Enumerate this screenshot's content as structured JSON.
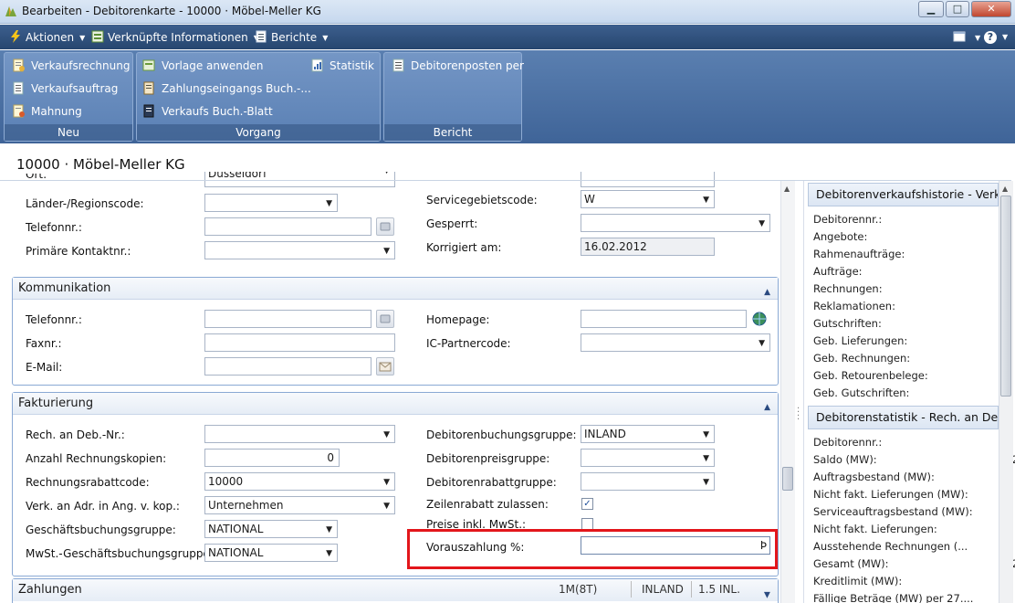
{
  "window": {
    "title": "Bearbeiten - Debitorenkarte - 10000 · Möbel-Meller KG",
    "buttons": {
      "minimize": "▁",
      "maximize": "□",
      "close": "✕"
    }
  },
  "menubar": {
    "actions": "Aktionen",
    "related": "Verknüpfte Informationen",
    "reports": "Berichte",
    "help": "?"
  },
  "ribbon": {
    "groups": [
      {
        "label": "Neu",
        "items": [
          "Verkaufsrechnung",
          "Verkaufsauftrag",
          "Mahnung"
        ]
      },
      {
        "label": "Vorgang",
        "items": [
          "Vorlage anwenden",
          "Zahlungseingangs Buch.-...",
          "Verkaufs Buch.-Blatt",
          "Statistik"
        ]
      },
      {
        "label": "Bericht",
        "items": [
          "Debitorenposten per"
        ]
      }
    ]
  },
  "page": {
    "title": "10000 · Möbel-Meller KG"
  },
  "general": {
    "ort_label": "Ort:",
    "ort_value": "Düsseldorf",
    "land_label": "Länder-/Regionscode:",
    "land_value": "",
    "telefon_label": "Telefonnr.:",
    "telefon_value": "",
    "kontakt_label": "Primäre Kontaktnr.:",
    "kontakt_value": "",
    "servicegebiet_label": "Servicegebietscode:",
    "servicegebiet_value": "W",
    "gesperrt_label": "Gesperrt:",
    "gesperrt_value": "",
    "korrigiert_label": "Korrigiert am:",
    "korrigiert_value": "16.02.2012"
  },
  "kommunikation": {
    "title": "Kommunikation",
    "telefon_label": "Telefonnr.:",
    "telefon_value": "",
    "fax_label": "Faxnr.:",
    "fax_value": "",
    "email_label": "E-Mail:",
    "email_value": "",
    "homepage_label": "Homepage:",
    "homepage_value": "",
    "icpartner_label": "IC-Partnercode:",
    "icpartner_value": ""
  },
  "fakturierung": {
    "title": "Fakturierung",
    "rechan_label": "Rech. an Deb.-Nr.:",
    "rechan_value": "",
    "kopien_label": "Anzahl Rechnungskopien:",
    "kopien_value": "0",
    "rabattcode_label": "Rechnungsrabattcode:",
    "rabattcode_value": "10000",
    "verkan_label": "Verk. an Adr. in Ang. v. kop.:",
    "verkan_value": "Unternehmen",
    "gesch_label": "Geschäftsbuchungsgruppe:",
    "gesch_value": "NATIONAL",
    "mwst_label": "MwSt.-Geschäftsbuchungsgruppe:",
    "mwst_value": "NATIONAL",
    "debbuch_label": "Debitorenbuchungsgruppe:",
    "debbuch_value": "INLAND",
    "debpreis_label": "Debitorenpreisgruppe:",
    "debpreis_value": "",
    "debrabatt_label": "Debitorenrabattgruppe:",
    "debrabatt_value": "",
    "zeilenrabatt_label": "Zeilenrabatt zulassen:",
    "zeilenrabatt_checked": "✓",
    "preise_label": "Preise inkl. MwSt.:",
    "voraus_label": "Vorauszahlung %:",
    "voraus_value": ""
  },
  "zahlungen": {
    "title": "Zahlungen",
    "summary1": "1M(8T)",
    "summary2": "INLAND",
    "summary3": "1.5 INL."
  },
  "factbox": {
    "history_title": "Debitorenverkaufshistorie - Verk...",
    "history_rows": [
      "Debitorennr.:",
      "Angebote:",
      "Rahmenaufträge:",
      "Aufträge:",
      "Rechnungen:",
      "Reklamationen:",
      "Gutschriften:",
      "Geb. Lieferungen:",
      "Geb. Rechnungen:",
      "Geb. Retourenbelege:",
      "Geb. Gutschriften:"
    ],
    "stats_title": "Debitorenstatistik - Rech. an Deb...",
    "stats_rows": [
      "Debitorennr.:",
      "Saldo (MW):",
      "Auftragsbestand (MW):",
      "Nicht fakt. Lieferungen (MW):",
      "Serviceauftragsbestand (MW):",
      "Nicht fakt. Lieferungen:",
      "Ausstehende Rechnungen (...",
      "Gesamt (MW):",
      "Kreditlimit (MW):",
      "Fällige Beträge (MW) per 27...."
    ],
    "saldo_partial": "2",
    "gesamt_partial": "2"
  },
  "colors": {
    "menubar": "#26466f",
    "ribbon": "#5a80b4",
    "highlight": "#e3161b",
    "section_border": "#8aa9d4"
  }
}
